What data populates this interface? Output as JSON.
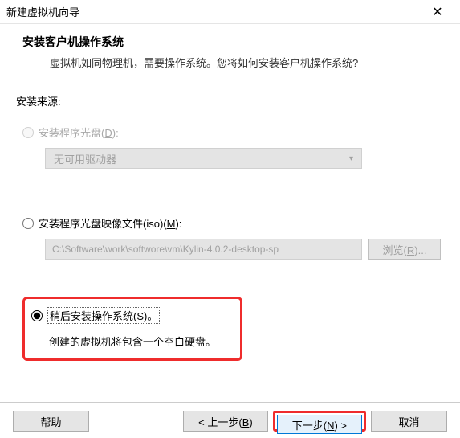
{
  "titlebar": {
    "title": "新建虚拟机向导",
    "close": "✕"
  },
  "header": {
    "title": "安装客户机操作系统",
    "subtitle": "虚拟机如同物理机，需要操作系统。您将如何安装客户机操作系统?"
  },
  "source": {
    "label": "安装来源:",
    "disc": {
      "label_prefix": "安装程序光盘(",
      "accel": "D",
      "label_suffix": "):",
      "dropdown": "无可用驱动器"
    },
    "iso": {
      "label_prefix": "安装程序光盘映像文件(iso)(",
      "accel": "M",
      "label_suffix": "):",
      "path": "C:\\Software\\work\\softwore\\vm\\Kylin-4.0.2-desktop-sp",
      "browse_prefix": "浏览(",
      "browse_accel": "R",
      "browse_suffix": ")..."
    },
    "later": {
      "label_prefix": "稍后安装操作系统(",
      "accel": "S",
      "label_suffix": ")。",
      "desc": "创建的虚拟机将包含一个空白硬盘。"
    }
  },
  "footer": {
    "help": "帮助",
    "back_prefix": "< 上一步(",
    "back_accel": "B",
    "back_suffix": ")",
    "next_prefix": "下一步(",
    "next_accel": "N",
    "next_suffix": ") >",
    "cancel": "取消"
  }
}
